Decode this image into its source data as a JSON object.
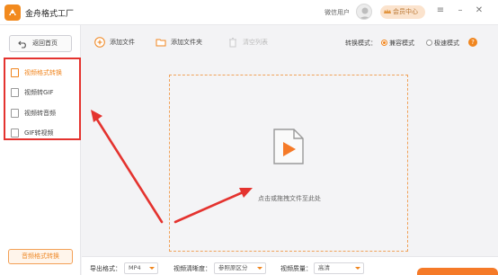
{
  "app": {
    "title": "金舟格式工厂",
    "user_name": "微信用户",
    "vip_label": "会员中心",
    "window_buttons": [
      "menu-icon",
      "minimize-icon",
      "close-icon"
    ]
  },
  "sidebar": {
    "back_label": "返回首页",
    "items": [
      {
        "label": "视频格式转换",
        "active": true
      },
      {
        "label": "视频转GIF",
        "active": false
      },
      {
        "label": "视频转音频",
        "active": false
      },
      {
        "label": "GIF转视频",
        "active": false
      }
    ],
    "bottom_label": "音频格式转换"
  },
  "toolbar": {
    "add_file": "添加文件",
    "add_folder": "添加文件夹",
    "clear_list": "清空列表",
    "mode_label": "转换模式：",
    "mode_options": [
      {
        "label": "兼容模式",
        "selected": true
      },
      {
        "label": "极速模式",
        "selected": false
      }
    ]
  },
  "workarea": {
    "drop_hint": "点击或拖拽文件至此处"
  },
  "bottombar": {
    "export_format_label": "导出格式：",
    "export_format_value": "MP4",
    "resolution_label": "视频清晰度：",
    "resolution_value": "参照原区分",
    "quality_label": "视频质量：",
    "quality_value": "高清"
  },
  "colors": {
    "accent": "#f0851e",
    "highlight_box": "#e4332f",
    "annotation_arrow": "#e4332f"
  }
}
